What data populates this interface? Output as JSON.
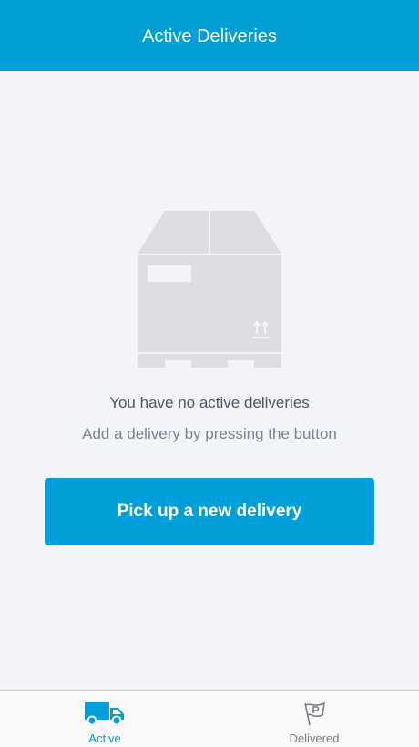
{
  "header": {
    "title": "Active Deliveries"
  },
  "empty_state": {
    "illustration": "package-box-icon",
    "title": "You have no active deliveries",
    "subtitle": "Add a delivery by pressing the button"
  },
  "cta": {
    "label": "Pick up a new delivery"
  },
  "tabbar": {
    "tabs": [
      {
        "label": "Active",
        "icon": "truck-icon",
        "selected": true
      },
      {
        "label": "Delivered",
        "icon": "flag-icon",
        "selected": false
      }
    ]
  },
  "colors": {
    "accent": "#009fd9",
    "background": "#f3f4f8",
    "illustration": "#dcdee1",
    "text_primary": "#515764",
    "text_secondary": "#7c8290",
    "tab_inactive": "#7b7f87"
  }
}
